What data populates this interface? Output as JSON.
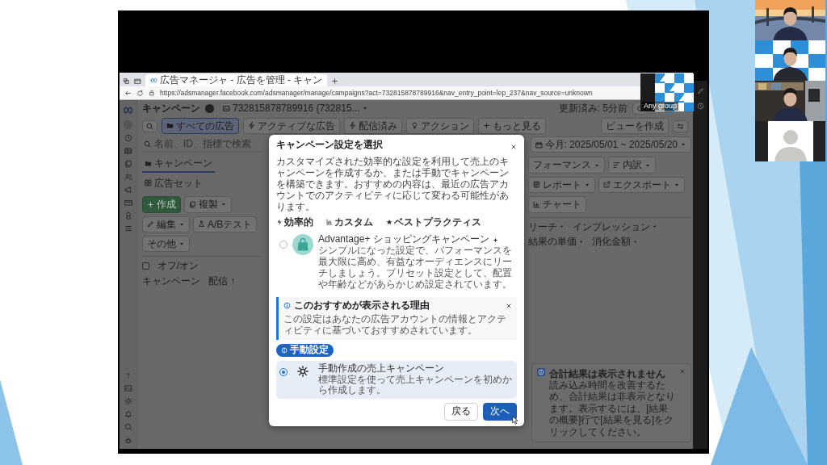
{
  "browser": {
    "tab_title": "広告マネージャ - 広告を管理 - キャン",
    "url": "https://adsmanager.facebook.com/adsmanager/manage/campaigns?act=732815878789916&nav_entry_point=lep_237&nav_source=unknown"
  },
  "ads_manager": {
    "section": "キャンペーン",
    "account": "732815878789916 (732815...",
    "updated": "更新済み: 5分前",
    "filters": [
      {
        "label": "すべての広告",
        "kind": "folder",
        "selected": true
      },
      {
        "label": "アクティブな広告",
        "kind": "active",
        "selected": false
      },
      {
        "label": "配信済み",
        "kind": "active",
        "selected": false
      },
      {
        "label": "アクション",
        "kind": "bulb",
        "selected": false
      },
      {
        "label": "もっと見る",
        "kind": "plus",
        "selected": false
      }
    ],
    "create_view": "ビューを作成",
    "search": {
      "placeholder": "名前、ID、指標で検索"
    },
    "level_tabs": [
      {
        "label": "キャンペーン",
        "kind": "folder",
        "selected": true
      },
      {
        "label": "広告セット",
        "kind": "grid",
        "selected": false
      }
    ],
    "date_range": "今月: 2025/05/01 ~ 2025/05/20",
    "toolbar_left": [
      {
        "label": "作成",
        "kind": "create",
        "dropdown": false
      },
      {
        "label": "複製",
        "kind": "duplicate",
        "dropdown": true
      },
      {
        "label": "編集",
        "kind": "edit",
        "dropdown": true
      },
      {
        "label": "A/Bテスト",
        "kind": "test",
        "dropdown": false
      },
      {
        "label": "その他",
        "kind": "plain",
        "dropdown": true
      }
    ],
    "toolbar_right": [
      {
        "label": "フォーマンス",
        "kind": "plain",
        "dropdown": true
      },
      {
        "label": "内訳",
        "kind": "breakdown",
        "dropdown": true
      },
      {
        "label": "レポート",
        "kind": "report",
        "dropdown": true
      },
      {
        "label": "エクスポート",
        "kind": "export",
        "dropdown": true
      },
      {
        "label": "チャート",
        "kind": "chart",
        "dropdown": false
      }
    ],
    "select_all": {
      "checked": false
    },
    "columns_left": [
      "オフ/オン",
      "キャンペーン",
      "配信 ↑"
    ],
    "columns_right": [
      "リーチ",
      "インプレッション",
      "結果の単価",
      "消化金額"
    ]
  },
  "modal": {
    "title": "キャンペーン設定を選択",
    "description": "カスタマイズされた効率的な設定を利用して売上のキャンペーンを作成するか、または手動でキャンペーンを構築できます。おすすめの内容は、最近の広告アカウントでのアクティビティに応じて変わる可能性があります。",
    "chips": [
      {
        "label": "効率的",
        "kind": "bolt"
      },
      {
        "label": "カスタム",
        "kind": "chart"
      },
      {
        "label": "ベストプラクティス",
        "kind": "star"
      }
    ],
    "recommended": {
      "title": "Advantage+ ショッピングキャンペーン",
      "description": "シンプルになった設定で、パフォーマンスを最大限に高め、有益なオーディエンスにリーチしましょう。プリセット設定として、配置や年齢などがあらかじめ設定されています。",
      "selected": false
    },
    "reason": {
      "title": "このおすすめが表示される理由",
      "text": "この設定はあなたの広告アカウントの情報とアクティビティに基づいておすすめされています。"
    },
    "manual_badge": "手動設定",
    "manual": {
      "title": "手動作成の売上キャンペーン",
      "description": "標準設定を使って売上キャンペーンを初めから作成します。",
      "selected": true
    },
    "buttons": [
      {
        "label": "戻る",
        "kind": "secondary"
      },
      {
        "label": "次へ",
        "kind": "primary"
      }
    ]
  },
  "toast": {
    "title": "合計結果は表示されません",
    "text": "読み込み時間を改善するため、合計結果は非表示となります。表示するには、[結果の概要]行で[結果を見る]をクリックしてください。"
  },
  "meeting": {
    "shared_tile": {
      "label": "Any group"
    },
    "tiles": [
      {
        "kind": "video"
      },
      {
        "kind": "video"
      },
      {
        "kind": "video"
      },
      {
        "kind": "avatar"
      }
    ]
  }
}
